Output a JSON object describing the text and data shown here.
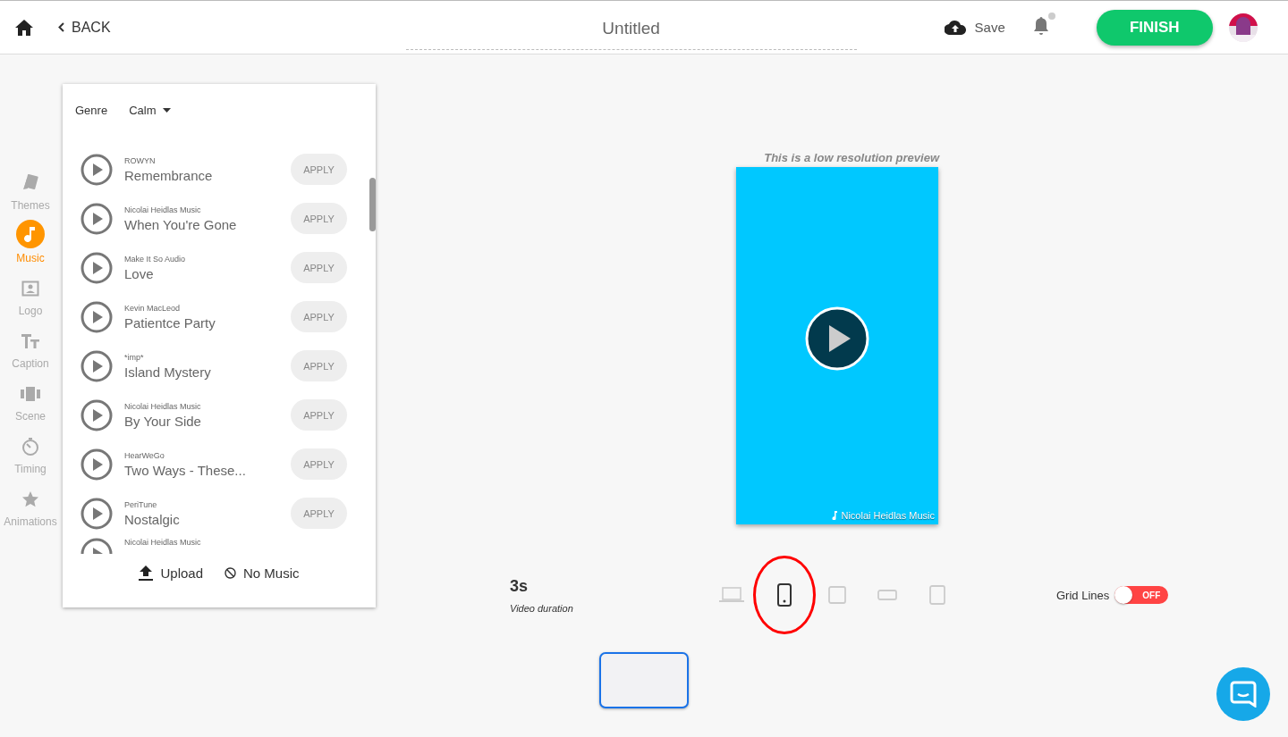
{
  "header": {
    "back": "BACK",
    "title": "Untitled",
    "save": "Save",
    "notification_unread": true,
    "finish": "FINISH"
  },
  "sidebar": {
    "items": [
      {
        "label": "Themes",
        "selected": false
      },
      {
        "label": "Music",
        "selected": true
      },
      {
        "label": "Logo",
        "selected": false
      },
      {
        "label": "Caption",
        "selected": false
      },
      {
        "label": "Scene",
        "selected": false
      },
      {
        "label": "Timing",
        "selected": false
      },
      {
        "label": "Animations",
        "selected": false
      }
    ]
  },
  "music_panel": {
    "genre_label": "Genre",
    "genre": "Calm",
    "tracks": [
      {
        "artist": "ROWYN",
        "title": "Remembrance",
        "apply": "APPLY"
      },
      {
        "artist": "Nicolai Heidlas Music",
        "title": "When You're Gone",
        "apply": "APPLY"
      },
      {
        "artist": "Make It So Audio",
        "title": "Love",
        "apply": "APPLY"
      },
      {
        "artist": "Kevin MacLeod",
        "title": "Patientce Party",
        "apply": "APPLY"
      },
      {
        "artist": "*imp*",
        "title": "Island Mystery",
        "apply": "APPLY"
      },
      {
        "artist": "Nicolai Heidlas Music",
        "title": "By Your Side",
        "apply": "APPLY"
      },
      {
        "artist": "HearWeGo",
        "title": "Two Ways - These...",
        "apply": "APPLY"
      },
      {
        "artist": "PeriTune",
        "title": "Nostalgic",
        "apply": "APPLY"
      },
      {
        "artist": "Nicolai Heidlas Music"
      }
    ],
    "upload": "Upload",
    "no_music": "No Music"
  },
  "preview": {
    "note": "This is a low resolution preview",
    "credit": "Nicolai Heidlas Music"
  },
  "duration": {
    "value": "3s",
    "label": "Video duration"
  },
  "formats": [
    {
      "kind": "laptop",
      "selected": false
    },
    {
      "kind": "phone",
      "selected": true
    },
    {
      "kind": "square",
      "selected": false
    },
    {
      "kind": "banner",
      "selected": false
    },
    {
      "kind": "portrait",
      "selected": false
    }
  ],
  "grid_lines": {
    "label": "Grid Lines",
    "on": false,
    "state": "OFF"
  },
  "scenes": [
    {
      "selected": true
    }
  ]
}
